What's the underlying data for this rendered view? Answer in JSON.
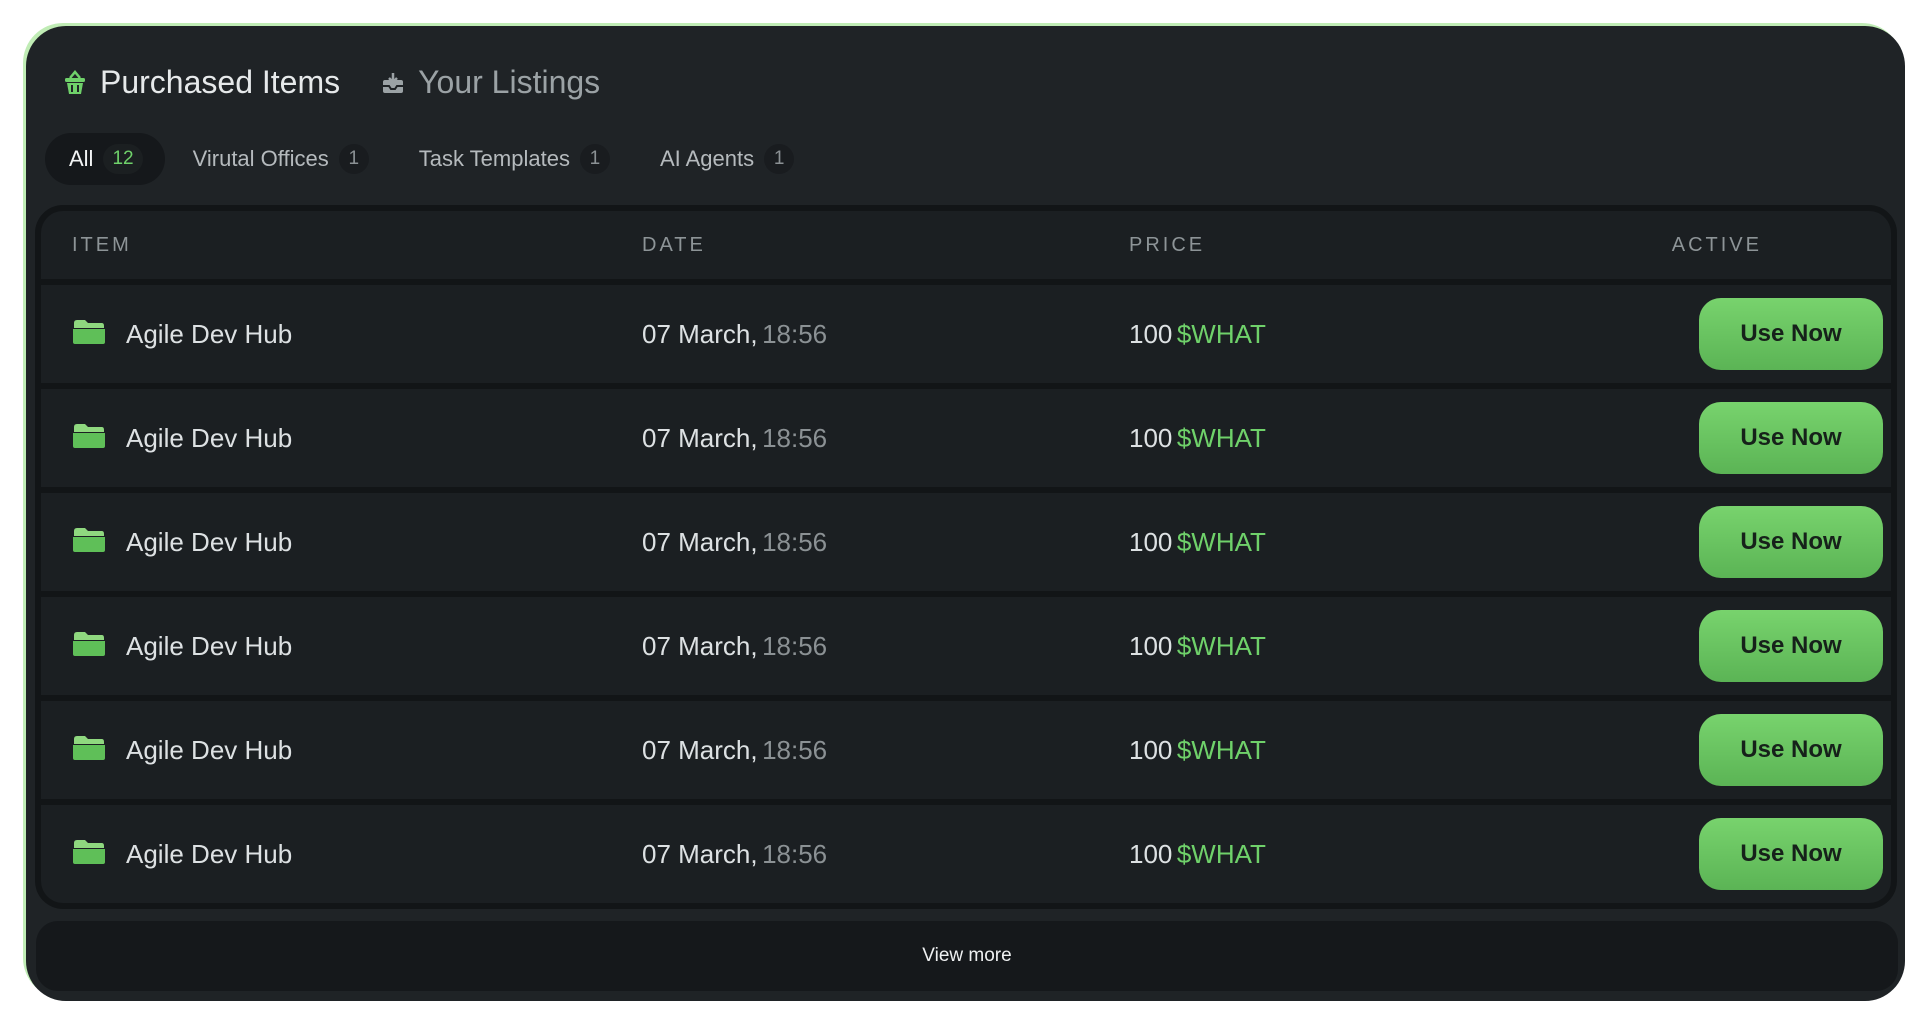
{
  "header_tabs": [
    {
      "label": "Purchased Items",
      "icon": "basket-icon"
    },
    {
      "label": "Your Listings",
      "icon": "inbox-icon"
    }
  ],
  "filters": [
    {
      "label": "All",
      "count": "12"
    },
    {
      "label": "Virutal Offices",
      "count": "1"
    },
    {
      "label": "Task Templates",
      "count": "1"
    },
    {
      "label": "AI Agents",
      "count": "1"
    }
  ],
  "table": {
    "headers": {
      "item": "ITEM",
      "date": "DATE",
      "price": "PRICE",
      "active": "ACTIVE"
    },
    "rows": [
      {
        "item": "Agile Dev Hub",
        "date": "07 March,",
        "time": "18:56",
        "amount": "100",
        "currency": "$WHAT",
        "action": "Use Now"
      },
      {
        "item": "Agile Dev Hub",
        "date": "07 March,",
        "time": "18:56",
        "amount": "100",
        "currency": "$WHAT",
        "action": "Use Now"
      },
      {
        "item": "Agile Dev Hub",
        "date": "07 March,",
        "time": "18:56",
        "amount": "100",
        "currency": "$WHAT",
        "action": "Use Now"
      },
      {
        "item": "Agile Dev Hub",
        "date": "07 March,",
        "time": "18:56",
        "amount": "100",
        "currency": "$WHAT",
        "action": "Use Now"
      },
      {
        "item": "Agile Dev Hub",
        "date": "07 March,",
        "time": "18:56",
        "amount": "100",
        "currency": "$WHAT",
        "action": "Use Now"
      },
      {
        "item": "Agile Dev Hub",
        "date": "07 March,",
        "time": "18:56",
        "amount": "100",
        "currency": "$WHAT",
        "action": "Use Now"
      }
    ]
  },
  "view_more_label": "View more",
  "colors": {
    "accent": "#6fd16a",
    "panel": "#1f2326",
    "row": "#1b1f22"
  }
}
